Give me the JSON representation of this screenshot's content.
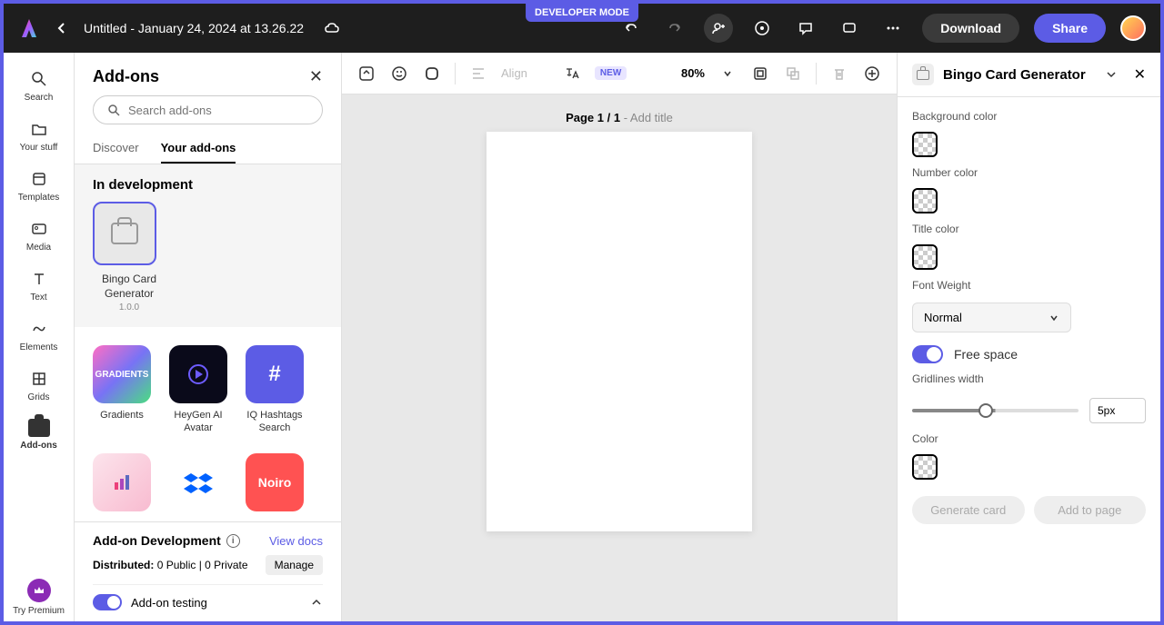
{
  "header": {
    "developer_mode": "DEVELOPER MODE",
    "title": "Untitled - January 24, 2024 at 13.26.22",
    "download": "Download",
    "share": "Share"
  },
  "left_rail": {
    "items": [
      {
        "label": "Search"
      },
      {
        "label": "Your stuff"
      },
      {
        "label": "Templates"
      },
      {
        "label": "Media"
      },
      {
        "label": "Text"
      },
      {
        "label": "Elements"
      },
      {
        "label": "Grids"
      },
      {
        "label": "Add-ons"
      },
      {
        "label": "Try Premium"
      }
    ]
  },
  "addons_panel": {
    "title": "Add-ons",
    "search_placeholder": "Search add-ons",
    "tabs": {
      "discover": "Discover",
      "your": "Your add-ons"
    },
    "in_development": "In development",
    "dev_addon": {
      "name": "Bingo Card Generator",
      "version": "1.0.0"
    },
    "grid": [
      {
        "name": "Gradients",
        "text": "GRADIENTS"
      },
      {
        "name": "HeyGen AI Avatar"
      },
      {
        "name": "IQ Hashtags Search",
        "text": "#"
      },
      {
        "name": ""
      },
      {
        "name": ""
      },
      {
        "name": "",
        "text": "Noiro"
      }
    ],
    "footer": {
      "title": "Add-on Development",
      "view_docs": "View docs",
      "distributed_label": "Distributed:",
      "distributed_value": "0 Public | 0 Private",
      "manage": "Manage",
      "testing": "Add-on testing"
    }
  },
  "canvas": {
    "toolbar": {
      "align": "Align",
      "new": "NEW",
      "zoom": "80%"
    },
    "page_label_bold": "Page 1 / 1",
    "page_label_rest": " - Add title"
  },
  "right_panel": {
    "title": "Bingo Card Generator",
    "bg_color": "Background color",
    "number_color": "Number color",
    "title_color": "Title color",
    "font_weight": "Font Weight",
    "font_weight_value": "Normal",
    "free_space": "Free space",
    "gridlines": "Gridlines width",
    "gridlines_value": "5px",
    "color": "Color",
    "generate": "Generate card",
    "add_to_page": "Add to page"
  }
}
